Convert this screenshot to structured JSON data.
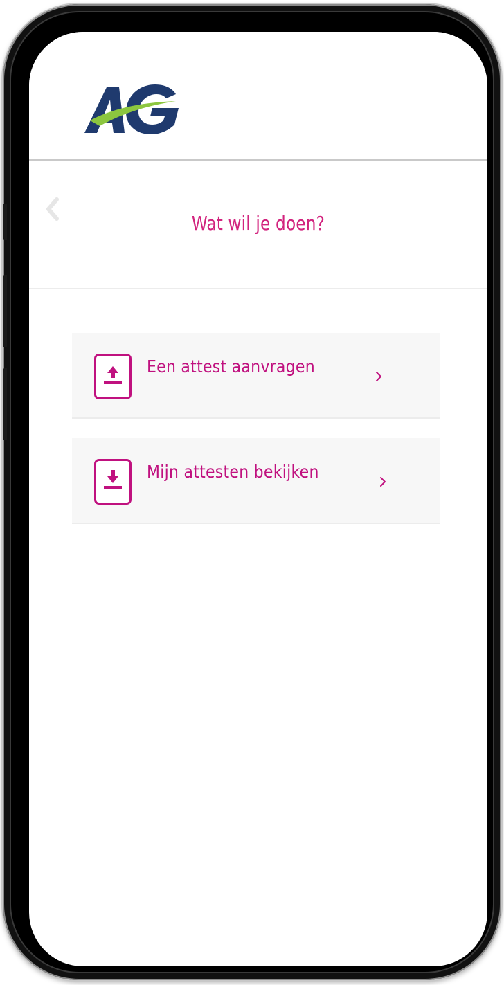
{
  "brand": {
    "logo_text": "AG",
    "colors": {
      "navy": "#1f3a6e",
      "green": "#8cc63f",
      "accent": "#c0117f",
      "title": "#d2237e"
    }
  },
  "header": {
    "back_icon": "chevron-left-icon"
  },
  "page": {
    "title": "Wat wil je doen?"
  },
  "options": [
    {
      "label": "Een attest aanvragen",
      "icon": "upload-icon",
      "arrow": "›"
    },
    {
      "label": "Mijn attesten bekijken",
      "icon": "download-icon",
      "arrow": "›"
    }
  ]
}
